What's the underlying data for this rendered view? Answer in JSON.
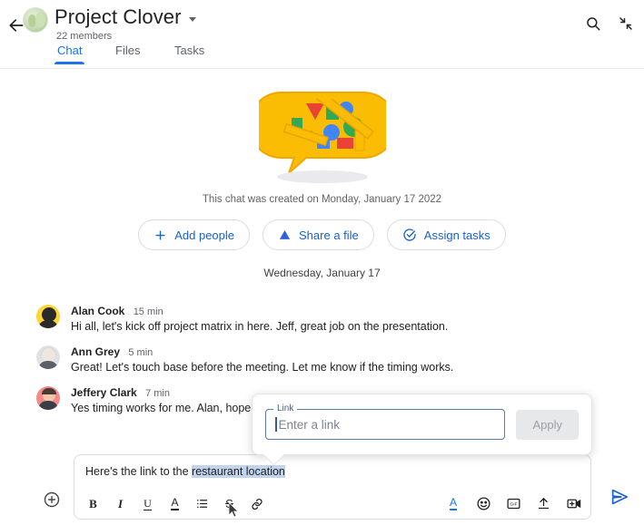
{
  "header": {
    "back_icon": "back-arrow-icon",
    "avatar_icon": "room-avatar",
    "title": "Project Clover",
    "caret_icon": "chevron-down-icon",
    "members": "22 members",
    "search_icon": "search-icon",
    "collapse_icon": "collapse-icon"
  },
  "tabs": [
    {
      "label": "Chat",
      "active": true
    },
    {
      "label": "Files",
      "active": false
    },
    {
      "label": "Tasks",
      "active": false
    }
  ],
  "intro": {
    "illustration": "chat-bubble-illustration",
    "created_text": "This chat was created on Monday, January 17 2022",
    "actions": [
      {
        "label": "Add people",
        "icon": "plus-icon"
      },
      {
        "label": "Share a file",
        "icon": "drive-icon"
      },
      {
        "label": "Assign tasks",
        "icon": "task-check-icon"
      }
    ],
    "date_divider": "Wednesday, January 17"
  },
  "messages": [
    {
      "name": "Alan Cook",
      "time": "15 min",
      "text": "Hi all, let's kick off project matrix in here. Jeff, great job on the presentation.",
      "avatar": "avatar-alan-cook"
    },
    {
      "name": "Ann Grey",
      "time": "5 min",
      "text": "Great! Let's touch base before the meeting. Let me know if the timing works.",
      "avatar": "avatar-ann-grey"
    },
    {
      "name": "Jeffery Clark",
      "time": "7 min",
      "text": "Yes timing works for me. Alan, hope yo",
      "avatar": "avatar-jeffery-clark"
    }
  ],
  "link_dialog": {
    "field_label": "Link",
    "placeholder": "Enter a link",
    "value": "",
    "apply_label": "Apply",
    "apply_disabled": true
  },
  "composer": {
    "add_icon": "plus-circle-icon",
    "text_before": "Here's the link to the ",
    "text_selected": "restaurant location",
    "format_tools": [
      {
        "icon": "bold-icon",
        "label": "B"
      },
      {
        "icon": "italic-icon",
        "label": "I"
      },
      {
        "icon": "underline-icon",
        "label": "U"
      },
      {
        "icon": "text-color-icon",
        "label": "A"
      },
      {
        "icon": "bulleted-list-icon",
        "label": ""
      },
      {
        "icon": "strikethrough-icon",
        "label": "S"
      },
      {
        "icon": "link-icon",
        "label": ""
      }
    ],
    "right_tools": [
      {
        "icon": "format-text-icon"
      },
      {
        "icon": "emoji-icon"
      },
      {
        "icon": "gif-icon"
      },
      {
        "icon": "upload-icon"
      },
      {
        "icon": "video-add-icon"
      }
    ],
    "send_icon": "send-icon"
  },
  "colors": {
    "accent_blue": "#1a73e8",
    "link_blue": "#1a5fd0",
    "selection": "#c2d3ee",
    "text": "#202124",
    "muted": "#5f6368",
    "border": "#dadce0"
  }
}
